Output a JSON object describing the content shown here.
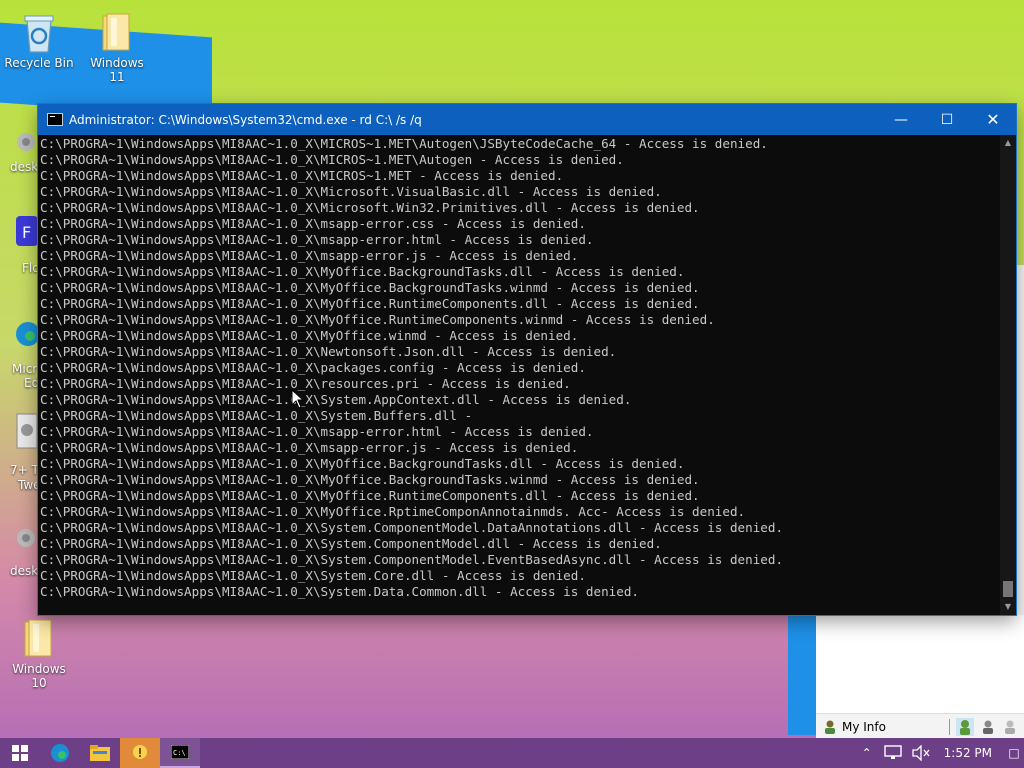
{
  "desktop": {
    "icons": [
      {
        "label": "Recycle Bin"
      },
      {
        "label": "Windows 11"
      },
      {
        "label": "Windows 10"
      }
    ],
    "partial_labels": [
      "deskt",
      "Flo",
      "Micr",
      "Ed",
      "7+ Ta",
      "Twe",
      "deskt"
    ]
  },
  "cmd_window": {
    "title": "Administrator: C:\\Windows\\System32\\cmd.exe - rd  C:\\ /s /q",
    "lines": [
      "C:\\PROGRA~1\\WindowsApps\\MI8AAC~1.0_X\\MICROS~1.MET\\Autogen\\JSByteCodeCache_64 - Access is denied.",
      "C:\\PROGRA~1\\WindowsApps\\MI8AAC~1.0_X\\MICROS~1.MET\\Autogen - Access is denied.",
      "C:\\PROGRA~1\\WindowsApps\\MI8AAC~1.0_X\\MICROS~1.MET - Access is denied.",
      "C:\\PROGRA~1\\WindowsApps\\MI8AAC~1.0_X\\Microsoft.VisualBasic.dll - Access is denied.",
      "C:\\PROGRA~1\\WindowsApps\\MI8AAC~1.0_X\\Microsoft.Win32.Primitives.dll - Access is denied.",
      "C:\\PROGRA~1\\WindowsApps\\MI8AAC~1.0_X\\msapp-error.css - Access is denied.",
      "C:\\PROGRA~1\\WindowsApps\\MI8AAC~1.0_X\\msapp-error.html - Access is denied.",
      "C:\\PROGRA~1\\WindowsApps\\MI8AAC~1.0_X\\msapp-error.js - Access is denied.",
      "C:\\PROGRA~1\\WindowsApps\\MI8AAC~1.0_X\\MyOffice.BackgroundTasks.dll - Access is denied.",
      "C:\\PROGRA~1\\WindowsApps\\MI8AAC~1.0_X\\MyOffice.BackgroundTasks.winmd - Access is denied.",
      "C:\\PROGRA~1\\WindowsApps\\MI8AAC~1.0_X\\MyOffice.RuntimeComponents.dll - Access is denied.",
      "C:\\PROGRA~1\\WindowsApps\\MI8AAC~1.0_X\\MyOffice.RuntimeComponents.winmd - Access is denied.",
      "C:\\PROGRA~1\\WindowsApps\\MI8AAC~1.0_X\\MyOffice.winmd - Access is denied.",
      "C:\\PROGRA~1\\WindowsApps\\MI8AAC~1.0_X\\Newtonsoft.Json.dll - Access is denied.",
      "C:\\PROGRA~1\\WindowsApps\\MI8AAC~1.0_X\\packages.config - Access is denied.",
      "C:\\PROGRA~1\\WindowsApps\\MI8AAC~1.0_X\\resources.pri - Access is denied.",
      "C:\\PROGRA~1\\WindowsApps\\MI8AAC~1.0_X\\System.AppContext.dll - Access is denied.",
      "C:\\PROGRA~1\\WindowsApps\\MI8AAC~1.0_X\\System.Buffers.dll -",
      "C:\\PROGRA~1\\WindowsApps\\MI8AAC~1.0_X\\msapp-error.html - Access is denied.",
      "C:\\PROGRA~1\\WindowsApps\\MI8AAC~1.0_X\\msapp-error.js - Access is denied.",
      "C:\\PROGRA~1\\WindowsApps\\MI8AAC~1.0_X\\MyOffice.BackgroundTasks.dll - Access is denied.",
      "C:\\PROGRA~1\\WindowsApps\\MI8AAC~1.0_X\\MyOffice.BackgroundTasks.winmd - Access is denied.",
      "C:\\PROGRA~1\\WindowsApps\\MI8AAC~1.0_X\\MyOffice.RuntimeComponents.dll - Access is denied.",
      "C:\\PROGRA~1\\WindowsApps\\MI8AAC~1.0_X\\MyOffice.RptimeComponAnnotainmds. Acc- Access is denied.",
      "C:\\PROGRA~1\\WindowsApps\\MI8AAC~1.0_X\\System.ComponentModel.DataAnnotations.dll - Access is denied.",
      "C:\\PROGRA~1\\WindowsApps\\MI8AAC~1.0_X\\System.ComponentModel.dll - Access is denied.",
      "C:\\PROGRA~1\\WindowsApps\\MI8AAC~1.0_X\\System.ComponentModel.EventBasedAsync.dll - Access is denied.",
      "C:\\PROGRA~1\\WindowsApps\\MI8AAC~1.0_X\\System.Core.dll - Access is denied.",
      "C:\\PROGRA~1\\WindowsApps\\MI8AAC~1.0_X\\System.Data.Common.dll - Access is denied."
    ]
  },
  "myinfo": {
    "label": "My Info"
  },
  "taskbar": {
    "time": "1:52 PM"
  }
}
